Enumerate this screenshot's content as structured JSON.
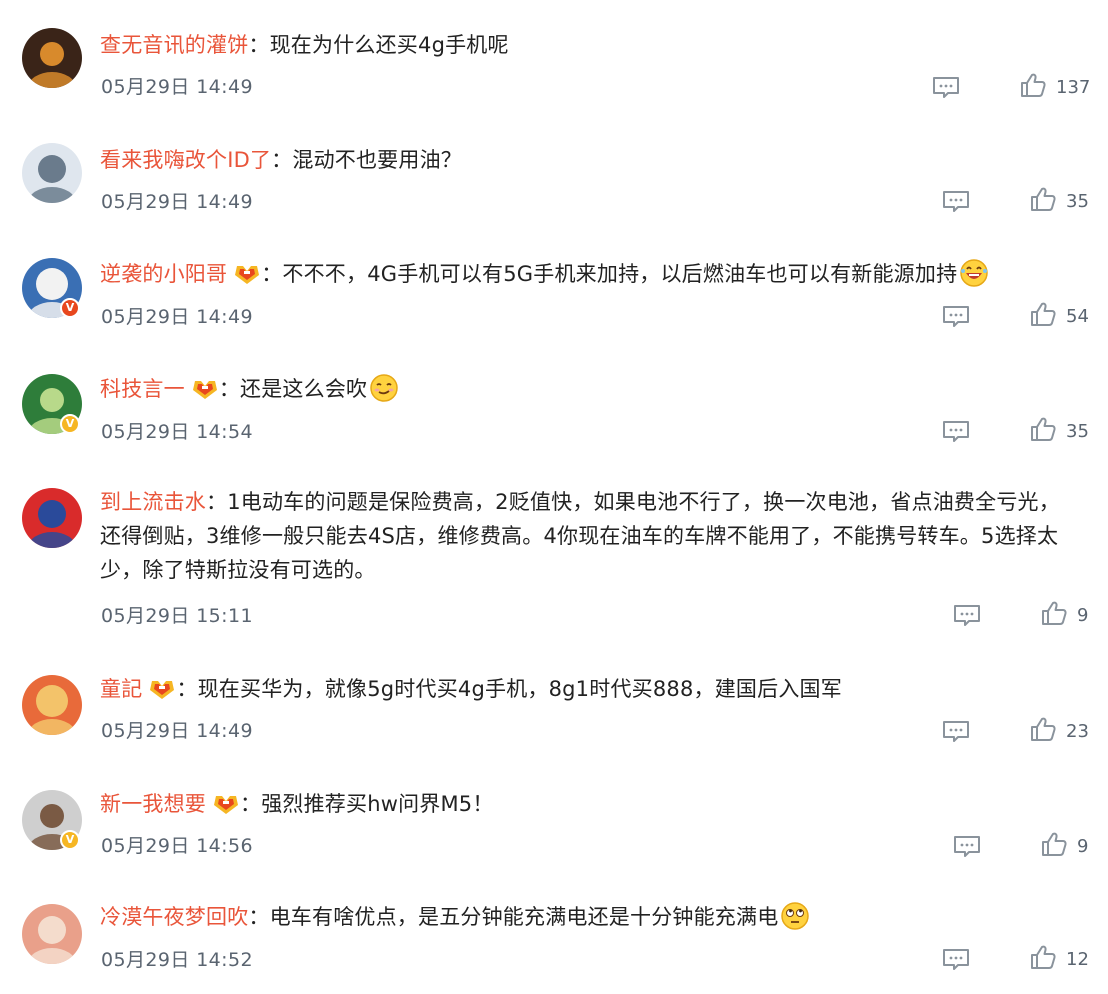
{
  "comments": [
    {
      "username": "查无音讯的灌饼",
      "separator": "：",
      "text": "现在为什么还买4g手机呢",
      "date": "05月29日 14:49",
      "likes": "137",
      "avatar_colors": [
        "#3a2418",
        "#d88a2c"
      ],
      "has_fan_badge": false,
      "emoji": "",
      "verified": ""
    },
    {
      "username": "看来我嗨改个ID了",
      "separator": "：",
      "text": "混动不也要用油？",
      "date": "05月29日 14:49",
      "likes": "35",
      "avatar_colors": [
        "#dfe6ee",
        "#6a7b8c"
      ],
      "has_fan_badge": false,
      "emoji": "",
      "verified": ""
    },
    {
      "username": "逆袭的小阳哥",
      "separator": "：",
      "text": "不不不，4G手机可以有5G手机来加持，以后燃油车也可以有新能源加持",
      "date": "05月29日 14:49",
      "likes": "54",
      "avatar_colors": [
        "#3a6fb4",
        "#f2f2f2"
      ],
      "has_fan_badge": true,
      "emoji": "laughing-face",
      "verified": "red"
    },
    {
      "username": "科技言一",
      "separator": "：",
      "text": "还是这么会吹",
      "date": "05月29日 14:54",
      "likes": "35",
      "avatar_colors": [
        "#2e7d3a",
        "#b8d98a"
      ],
      "has_fan_badge": true,
      "emoji": "smug-face",
      "verified": "gold"
    },
    {
      "username": "到上流击水",
      "separator": "：",
      "text": "1电动车的问题是保险费高，2贬值快，如果电池不行了，换一次电池，省点油费全亏光，还得倒贴，3维修一般只能去4S店，维修费高。4你现在油车的车牌不能用了，不能携号转车。5选择太少，除了特斯拉没有可选的。",
      "text_lines": [
        "1电动车的问题是保险费高，2贬值快，如果电池不行了，换一次电池，省点油费全亏光，",
        "还得倒贴，3维修一般只能去4S店，维修费高。4你现在油车的车牌不能用了，不能携号转车。5选择太",
        "少，除了特斯拉没有可选的。"
      ],
      "date": "05月29日 15:11",
      "likes": "9",
      "avatar_colors": [
        "#d92b2b",
        "#2a4a9a"
      ],
      "has_fan_badge": false,
      "emoji": "",
      "verified": ""
    },
    {
      "username": "童記",
      "separator": "：",
      "text": "现在买华为，就像5g时代买4g手机，8g1时代买888，建国后入国军",
      "date": "05月29日 14:49",
      "likes": "23",
      "avatar_colors": [
        "#e86a3a",
        "#f3c36a"
      ],
      "has_fan_badge": true,
      "emoji": "",
      "verified": ""
    },
    {
      "username": "新一我想要",
      "separator": "：",
      "text": "强烈推荐买hw问界M5！",
      "date": "05月29日 14:56",
      "likes": "9",
      "avatar_colors": [
        "#cfcfcf",
        "#7a5a44"
      ],
      "has_fan_badge": true,
      "emoji": "",
      "verified": "gold"
    },
    {
      "username": "冷漠午夜梦回吹",
      "separator": "：",
      "text": "电车有啥优点，是五分钟能充满电还是十分钟能充满电",
      "date": "05月29日 14:52",
      "likes": "12",
      "avatar_colors": [
        "#e9a08a",
        "#f4dccc"
      ],
      "has_fan_badge": false,
      "emoji": "eye-roll-face",
      "verified": ""
    }
  ],
  "icons": {
    "reply": "comment-icon",
    "like": "thumbs-up-icon",
    "fan_badge": "fan-club-badge-icon",
    "verified": "v-icon"
  },
  "colors": {
    "username": "#e9553a",
    "meta": "#5a6470",
    "text": "#222222",
    "icon_stroke": "#8a939c"
  }
}
